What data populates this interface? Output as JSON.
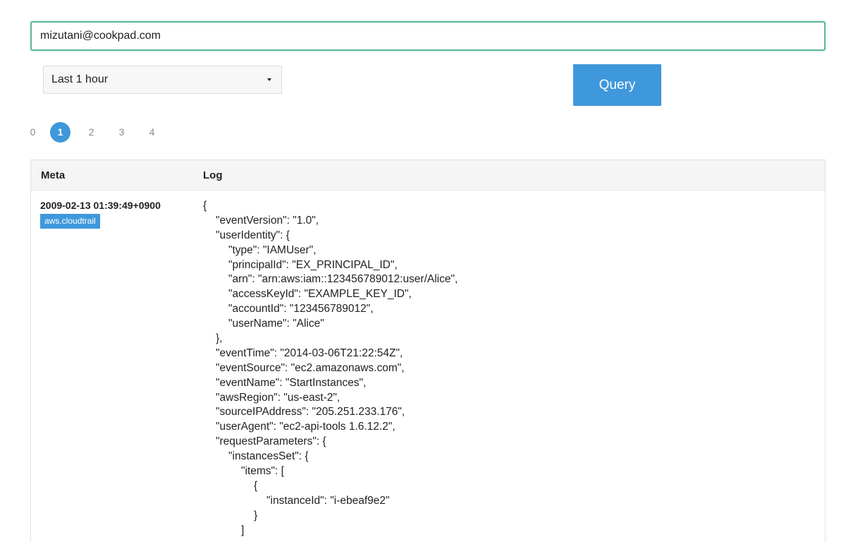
{
  "search": {
    "value": "mizutani@cookpad.com",
    "placeholder": ""
  },
  "time_range": {
    "selected": "Last 1 hour"
  },
  "query_button": {
    "label": "Query"
  },
  "pagination": {
    "pages": [
      "0",
      "1",
      "2",
      "3",
      "4"
    ],
    "active": "1"
  },
  "table": {
    "headers": {
      "meta": "Meta",
      "log": "Log"
    },
    "rows": [
      {
        "timestamp": "2009-02-13 01:39:49+0900",
        "source": "aws.cloudtrail",
        "log_lines": [
          {
            "indent": 0,
            "text": "{"
          },
          {
            "indent": 1,
            "text": "\"eventVersion\": \"1.0\","
          },
          {
            "indent": 1,
            "text": "\"userIdentity\": {"
          },
          {
            "indent": 2,
            "text": "\"type\": \"IAMUser\","
          },
          {
            "indent": 2,
            "text": "\"principalId\": \"EX_PRINCIPAL_ID\","
          },
          {
            "indent": 2,
            "text": "\"arn\": \"arn:aws:iam::123456789012:user/Alice\","
          },
          {
            "indent": 2,
            "text": "\"accessKeyId\": \"EXAMPLE_KEY_ID\","
          },
          {
            "indent": 2,
            "text": "\"accountId\": \"123456789012\","
          },
          {
            "indent": 2,
            "text": "\"userName\": \"Alice\""
          },
          {
            "indent": 1,
            "text": "},"
          },
          {
            "indent": 1,
            "text": "\"eventTime\": \"2014-03-06T21:22:54Z\","
          },
          {
            "indent": 1,
            "text": "\"eventSource\": \"ec2.amazonaws.com\","
          },
          {
            "indent": 1,
            "text": "\"eventName\": \"StartInstances\","
          },
          {
            "indent": 1,
            "text": "\"awsRegion\": \"us-east-2\","
          },
          {
            "indent": 1,
            "text": "\"sourceIPAddress\": \"205.251.233.176\","
          },
          {
            "indent": 1,
            "text": "\"userAgent\": \"ec2-api-tools 1.6.12.2\","
          },
          {
            "indent": 1,
            "text": "\"requestParameters\": {"
          },
          {
            "indent": 2,
            "text": "\"instancesSet\": {"
          },
          {
            "indent": 3,
            "text": "\"items\": ["
          },
          {
            "indent": 4,
            "text": "{"
          },
          {
            "indent": 5,
            "text": "\"instanceId\": \"i-ebeaf9e2\""
          },
          {
            "indent": 4,
            "text": "}"
          },
          {
            "indent": 3,
            "text": "]"
          }
        ]
      }
    ]
  },
  "colors": {
    "accent": "#3f98dc",
    "focus_border": "#5cb89a"
  }
}
